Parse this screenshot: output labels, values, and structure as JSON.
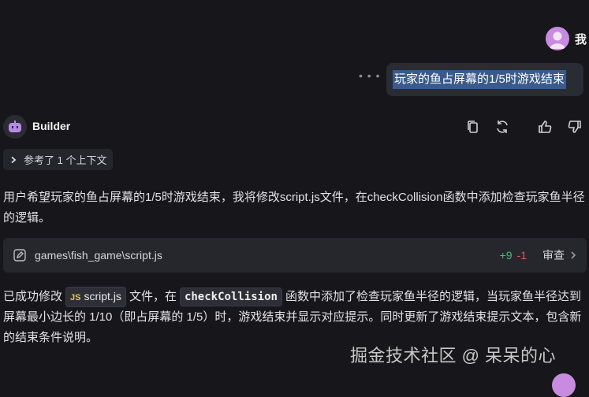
{
  "user": {
    "name": "我",
    "message": "玩家的鱼占屏幕的1/5时游戏结束",
    "more_icon": "more-dots-icon"
  },
  "assistant": {
    "name": "Builder",
    "actions": [
      "copy-icon",
      "refresh-icon",
      "thumbs-up-icon",
      "thumbs-down-icon"
    ],
    "context_chip": "参考了 1 个上下文",
    "intro": "用户希望玩家的鱼占屏幕的1/5时游戏结束，我将修改script.js文件，在checkCollision函数中添加检查玩家鱼半径的逻辑。",
    "file": {
      "path": "games\\fish_game\\script.js",
      "added": "+9",
      "removed": "-1",
      "review_label": "审查"
    },
    "result": {
      "prefix": "已成功修改",
      "file_chip_badge": "JS",
      "file_chip": "script.js",
      "mid1": "文件，在",
      "code_chip": "checkCollision",
      "suffix": "函数中添加了检查玩家鱼半径的逻辑，当玩家鱼半径达到屏幕最小边长的 1/10（即占屏幕的 1/5）时，游戏结束并显示对应提示。同时更新了游戏结束提示文本，包含新的结束条件说明。"
    }
  },
  "watermark": "掘金技术社区 @ 呆呆的心",
  "colors": {
    "background": "#17171b",
    "bubble": "#2a2c33",
    "highlight": "#3a5a8c",
    "added": "#3fbf7f",
    "removed": "#e05a5a"
  }
}
